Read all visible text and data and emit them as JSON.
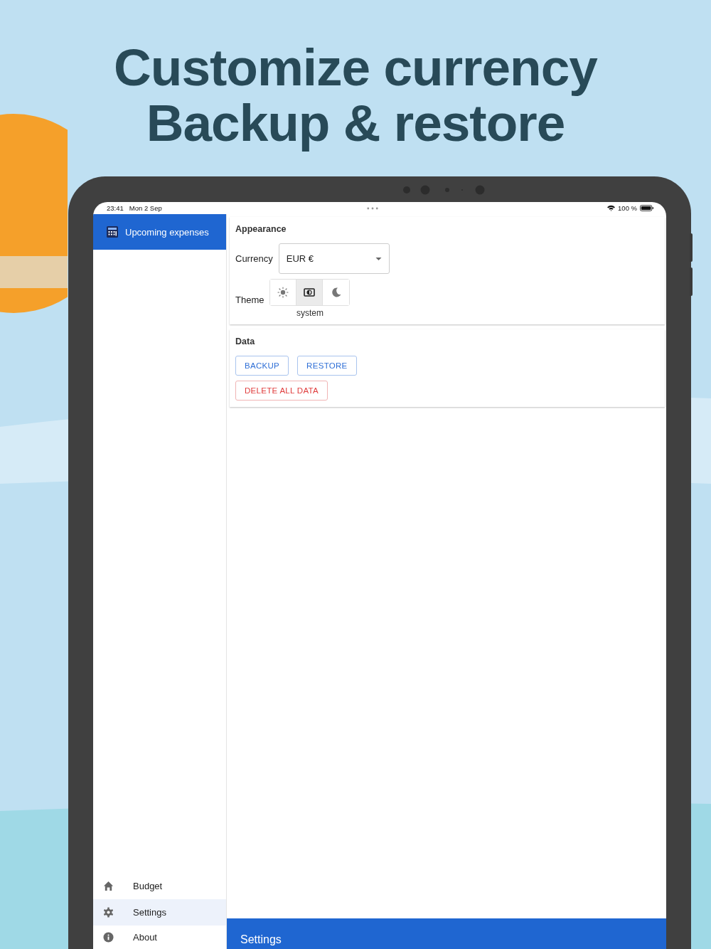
{
  "headline": [
    "Customize currency",
    "Backup & restore"
  ],
  "status_bar": {
    "time": "23:41",
    "date": "Mon 2 Sep",
    "battery": "100 %"
  },
  "sidebar": {
    "app_title": "Upcoming expenses",
    "items": [
      {
        "label": "Budget",
        "selected": false
      },
      {
        "label": "Settings",
        "selected": true
      },
      {
        "label": "About",
        "selected": false
      }
    ]
  },
  "appearance": {
    "title": "Appearance",
    "currency": {
      "label": "Currency",
      "value": "EUR €"
    },
    "theme": {
      "label": "Theme",
      "options": [
        {
          "selected": false
        },
        {
          "selected": true
        },
        {
          "selected": false
        }
      ],
      "caption": "system"
    }
  },
  "data": {
    "title": "Data",
    "buttons": [
      {
        "label": "BACKUP",
        "kind": "normal"
      },
      {
        "label": "RESTORE",
        "kind": "normal"
      },
      {
        "label": "DELETE ALL DATA",
        "kind": "danger"
      }
    ]
  },
  "bottom_bar": {
    "title": "Settings"
  }
}
